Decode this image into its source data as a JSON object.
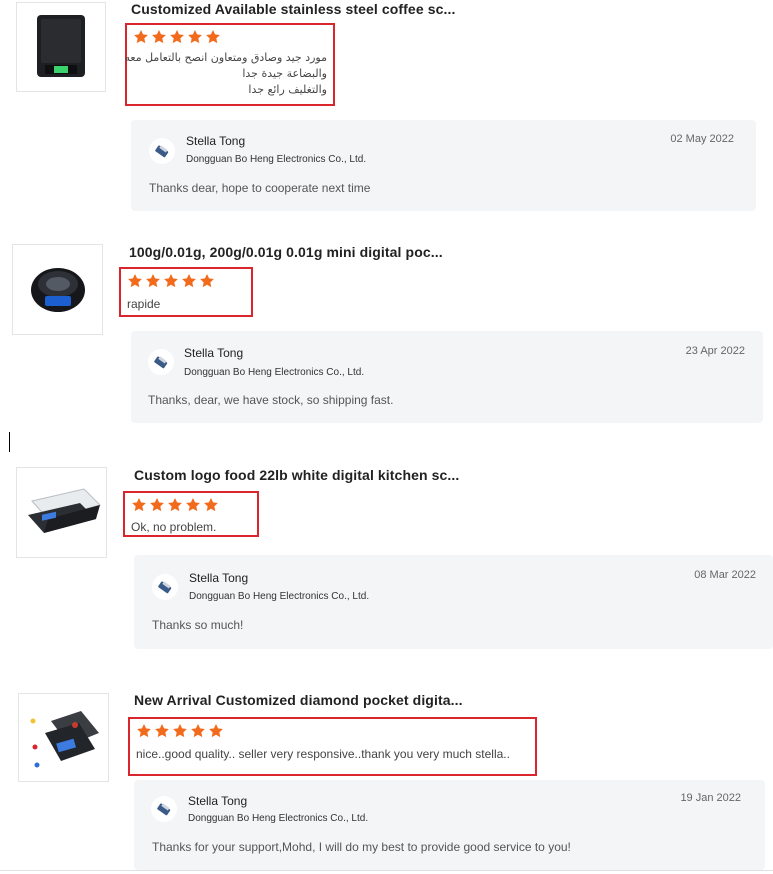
{
  "reviews": [
    {
      "product_title": "Customized Available stainless steel coffee sc...",
      "rating": 5,
      "review_lines": [
        "مورد جيد وصادق ومتعاون انصح بالتعامل معه",
        "والبضاعة جيدة جدا",
        "والتغليف رائع جدا"
      ],
      "reply": {
        "name": "Stella Tong",
        "company": "Dongguan Bo Heng Electronics Co., Ltd.",
        "date": "02 May 2022",
        "message": "Thanks dear, hope to cooperate next time"
      }
    },
    {
      "product_title": "100g/0.01g, 200g/0.01g 0.01g mini digital poc...",
      "rating": 5,
      "review_lines": [
        "rapide"
      ],
      "reply": {
        "name": "Stella Tong",
        "company": "Dongguan Bo Heng Electronics Co., Ltd.",
        "date": "23 Apr 2022",
        "message": "Thanks, dear, we have stock, so shipping fast."
      }
    },
    {
      "product_title": "Custom logo food 22lb white digital kitchen sc...",
      "rating": 5,
      "review_lines": [
        "Ok, no problem."
      ],
      "reply": {
        "name": "Stella Tong",
        "company": "Dongguan Bo Heng Electronics Co., Ltd.",
        "date": "08 Mar 2022",
        "message": "Thanks so much!"
      }
    },
    {
      "product_title": "New Arrival Customized diamond pocket digita...",
      "rating": 5,
      "review_lines": [
        "nice..good quality.. seller very responsive..thank you very much stella.."
      ],
      "reply": {
        "name": "Stella Tong",
        "company": "Dongguan Bo Heng Electronics Co., Ltd.",
        "date": "19 Jan 2022",
        "message": "Thanks for your support,Mohd, I will do my best to provide good service to you!"
      }
    }
  ],
  "colors": {
    "star": "#f26b1d",
    "highlight_border": "#d9262c",
    "reply_bg": "#f4f5f7"
  },
  "icons": {
    "star": "star-icon",
    "avatar": "supplier-logo-icon"
  }
}
